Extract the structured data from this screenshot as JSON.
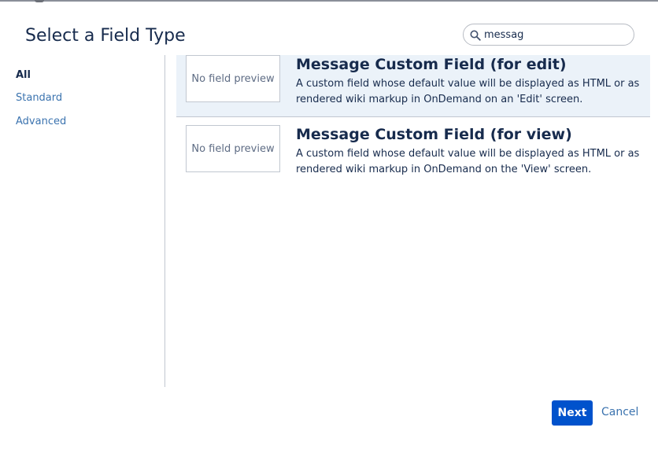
{
  "dialog": {
    "title": "Select a Field Type"
  },
  "search": {
    "value": "messag",
    "icon": "search-icon"
  },
  "sidebar": {
    "items": [
      {
        "label": "All",
        "active": true
      },
      {
        "label": "Standard",
        "active": false
      },
      {
        "label": "Advanced",
        "active": false
      }
    ]
  },
  "results": [
    {
      "preview": "No field preview",
      "title": "Message Custom Field (for edit)",
      "description": "A custom field whose default value will be displayed as HTML or as rendered wiki markup in OnDemand on an 'Edit' screen.",
      "selected": true
    },
    {
      "preview": "No field preview",
      "title": "Message Custom Field (for view)",
      "description": "A custom field whose default value will be displayed as HTML or as rendered wiki markup in OnDemand on the 'View' screen.",
      "selected": false
    }
  ],
  "footer": {
    "next_label": "Next",
    "cancel_label": "Cancel"
  },
  "colors": {
    "primary": "#0052cc",
    "link": "#3b73af",
    "selected_bg": "#ebf2f9",
    "text": "#172b4d"
  }
}
